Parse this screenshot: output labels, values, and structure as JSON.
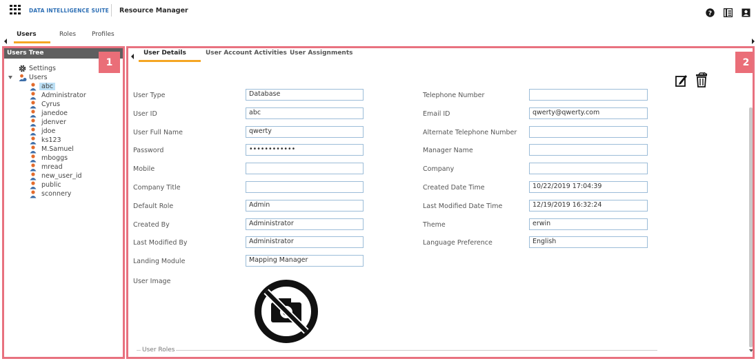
{
  "header": {
    "brand": "DATA INTELLIGENCE SUITE",
    "app_title": "Resource Manager",
    "icons": [
      "help-icon",
      "docs-icon",
      "user-icon"
    ]
  },
  "top_tabs": [
    {
      "label": "Users",
      "active": true
    },
    {
      "label": "Roles",
      "active": false
    },
    {
      "label": "Profiles",
      "active": false
    }
  ],
  "left_panel": {
    "title": "Users Tree",
    "badge": "1",
    "settings_label": "Settings",
    "users_label": "Users",
    "users": [
      "abc",
      "Administrator",
      "Cyrus",
      "janedoe",
      "jdenver",
      "jdoe",
      "ks123",
      "M.Samuel",
      "mboggs",
      "mread",
      "new_user_id",
      "public",
      "sconnery"
    ],
    "selected_user": "abc"
  },
  "right_panel": {
    "badge": "2",
    "tabs": [
      {
        "label": "User Details",
        "active": true
      },
      {
        "label": "User Account Activities",
        "active": false
      },
      {
        "label": "User Assignments",
        "active": false
      }
    ],
    "left_fields": [
      {
        "label": "User Type",
        "value": "Database"
      },
      {
        "label": "User ID",
        "value": "abc"
      },
      {
        "label": "User Full Name",
        "value": "qwerty"
      },
      {
        "label": "Password",
        "value": "••••••••••••"
      },
      {
        "label": "Mobile",
        "value": ""
      },
      {
        "label": "Company Title",
        "value": ""
      },
      {
        "label": "Default Role",
        "value": "Admin"
      },
      {
        "label": "Created By",
        "value": "Administrator"
      },
      {
        "label": "Last Modified By",
        "value": "Administrator"
      },
      {
        "label": "Landing Module",
        "value": "Mapping Manager"
      }
    ],
    "right_fields": [
      {
        "label": "Telephone Number",
        "value": ""
      },
      {
        "label": "Email ID",
        "value": "qwerty@qwerty.com"
      },
      {
        "label": "Alternate Telephone Number",
        "value": ""
      },
      {
        "label": "Manager Name",
        "value": ""
      },
      {
        "label": "Company",
        "value": ""
      },
      {
        "label": "Created Date Time",
        "value": "10/22/2019 17:04:39"
      },
      {
        "label": "Last Modified Date Time",
        "value": "12/19/2019 16:32:24"
      },
      {
        "label": "Theme",
        "value": "erwin"
      },
      {
        "label": "Language Preference",
        "value": "English"
      }
    ],
    "user_image_label": "User Image",
    "user_roles_label": "User Roles"
  },
  "colors": {
    "accent": "#f5a623",
    "highlight_border": "#e8717f",
    "badge": "#ea6e78",
    "brand": "#2d6fb5",
    "selection": "#bde0f5",
    "input_border": "#9bbcd8"
  }
}
